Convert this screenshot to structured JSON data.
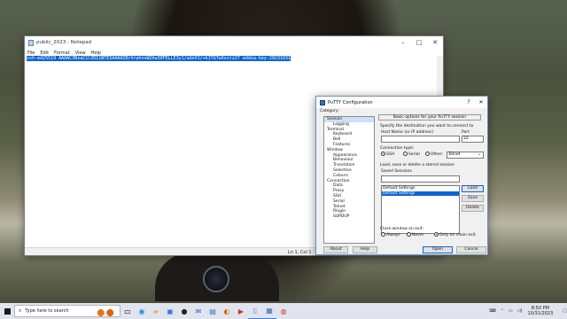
{
  "notepad": {
    "title": "public_2023 - Notepad",
    "menu": [
      "File",
      "Edit",
      "Format",
      "View",
      "Help"
    ],
    "content": "ssh-ed25519 AAAAC3NzaC1lZDI1NTE5AAAAIBrXrwhnvW2hw30FELLE3y1/aUxV1/+kIYGTwXxxtz27 eddsa-key-20231031",
    "status_position": "Ln 1, Col 1"
  },
  "putty": {
    "title": "PuTTY Configuration",
    "category_label": "Category:",
    "tree": [
      {
        "label": "Session",
        "level": 0,
        "selected": true
      },
      {
        "label": "Logging",
        "level": 1
      },
      {
        "label": "Terminal",
        "level": 0
      },
      {
        "label": "Keyboard",
        "level": 1
      },
      {
        "label": "Bell",
        "level": 1
      },
      {
        "label": "Features",
        "level": 1
      },
      {
        "label": "Window",
        "level": 0
      },
      {
        "label": "Appearance",
        "level": 1
      },
      {
        "label": "Behaviour",
        "level": 1
      },
      {
        "label": "Translation",
        "level": 1
      },
      {
        "label": "Selection",
        "level": 1
      },
      {
        "label": "Colours",
        "level": 1
      },
      {
        "label": "Connection",
        "level": 0
      },
      {
        "label": "Data",
        "level": 1
      },
      {
        "label": "Proxy",
        "level": 1
      },
      {
        "label": "SSH",
        "level": 1
      },
      {
        "label": "Serial",
        "level": 1
      },
      {
        "label": "Telnet",
        "level": 1
      },
      {
        "label": "Rlogin",
        "level": 1
      },
      {
        "label": "SUPDUP",
        "level": 1
      }
    ],
    "header": "Basic options for your PuTTY session",
    "destination_label": "Specify the destination you want to connect to",
    "host_label": "Host Name (or IP address)",
    "host_value": "",
    "port_label": "Port",
    "port_value": "22",
    "conn_type_label": "Connection type:",
    "conn_types": [
      "SSH",
      "Serial",
      "Other:"
    ],
    "other_select": "Telnet",
    "sessions_group_label": "Load, save or delete a stored session",
    "saved_sessions_label": "Saved Sessions",
    "saved_sessions_value": "",
    "sessions": [
      "Default Settings",
      "Default Settings"
    ],
    "load_button": "Load",
    "save_button": "Save",
    "delete_button": "Delete",
    "close_label": "Close window on exit:",
    "close_options": [
      "Always",
      "Never",
      "Only on clean exit"
    ],
    "about_button": "About",
    "help_button": "Help",
    "open_button": "Open",
    "cancel_button": "Cancel"
  },
  "taskbar": {
    "search_placeholder": "Type here to search",
    "time": "8:50 PM",
    "date": "10/31/2023"
  }
}
